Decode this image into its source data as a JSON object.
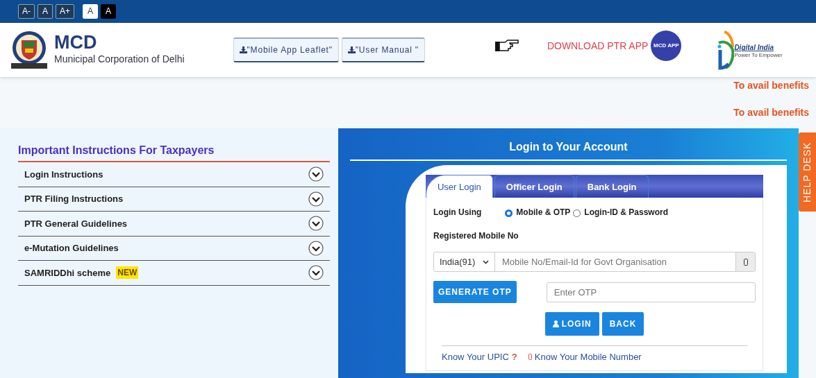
{
  "font_controls": [
    {
      "label": "A-",
      "kind": "size"
    },
    {
      "label": "A",
      "kind": "size"
    },
    {
      "label": "A+",
      "kind": "size"
    },
    {
      "label": "A",
      "kind": "light"
    },
    {
      "label": "A",
      "kind": "dark"
    }
  ],
  "header": {
    "brand": "MCD",
    "subtitle": "Municipal Corporation of Delhi",
    "buttons": [
      "\"Mobile App Leaflet\"",
      "\"User Manual \""
    ],
    "download_text": "DOWNLOAD PTR APP",
    "app_badge": "MCD APP",
    "digital_india": {
      "title": "Digital India",
      "tagline": "Power To Empower"
    }
  },
  "notices": [
    "To avail benefits",
    "To avail benefits"
  ],
  "instructions": {
    "title": "Important Instructions For Taxpayers",
    "items": [
      {
        "label": "Login Instructions",
        "expanded": false
      },
      {
        "label": "PTR Filing Instructions",
        "expanded": false
      },
      {
        "label": "PTR General Guidelines",
        "expanded": false
      },
      {
        "label": "e-Mutation Guidelines",
        "expanded": false
      },
      {
        "label": "SAMRIDDhi scheme",
        "badge": "NEW",
        "expanded": false
      }
    ]
  },
  "login": {
    "title": "Login to Your Account",
    "tabs": [
      {
        "label": "User Login",
        "selected": true
      },
      {
        "label": "Officer Login",
        "selected": false
      },
      {
        "label": "Bank Login",
        "selected": false
      }
    ],
    "login_using": "Login Using",
    "options": [
      {
        "label": "Mobile & OTP",
        "selected": true
      },
      {
        "label": "Login-ID & Password",
        "selected": false
      }
    ],
    "mobile_label": "Registered Mobile No",
    "country": "India(91)",
    "mobile_placeholder": "Mobile No/Email-Id for Govt Organisation",
    "otp_button": "GENERATE OTP",
    "otp_placeholder": "Enter OTP",
    "buttons": [
      "LOGIN",
      "BACK"
    ],
    "links": [
      {
        "label": "Know Your UPIC",
        "mark": "?"
      },
      {
        "label": "Know Your Mobile Number"
      }
    ]
  },
  "help_desk": "HELP DESK"
}
